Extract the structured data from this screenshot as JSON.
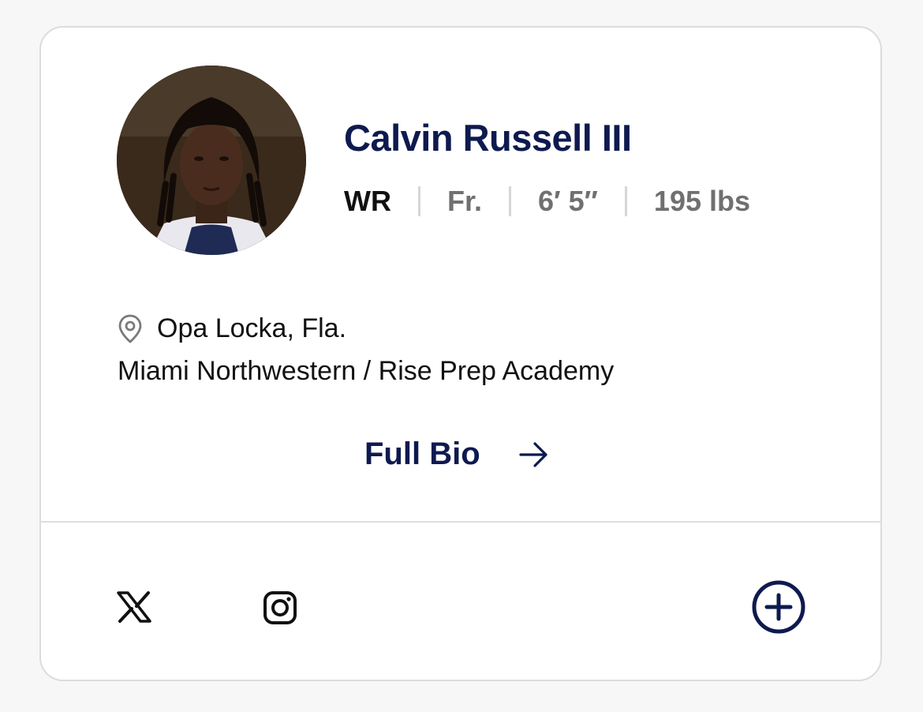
{
  "player": {
    "name": "Calvin Russell III",
    "position": "WR",
    "class_year": "Fr.",
    "height": "6′ 5″",
    "weight": "195 lbs",
    "hometown": "Opa Locka, Fla.",
    "schools": "Miami Northwestern / Rise Prep Academy"
  },
  "actions": {
    "full_bio_label": "Full Bio"
  },
  "icons": {
    "location": "map-pin-icon",
    "full_bio": "arrow-right-icon",
    "x": "x-logo-icon",
    "instagram": "instagram-icon",
    "add": "plus-circle-icon"
  },
  "colors": {
    "brand_navy": "#0e1a4f",
    "muted_text": "#707070",
    "border": "#dcdcdc"
  }
}
